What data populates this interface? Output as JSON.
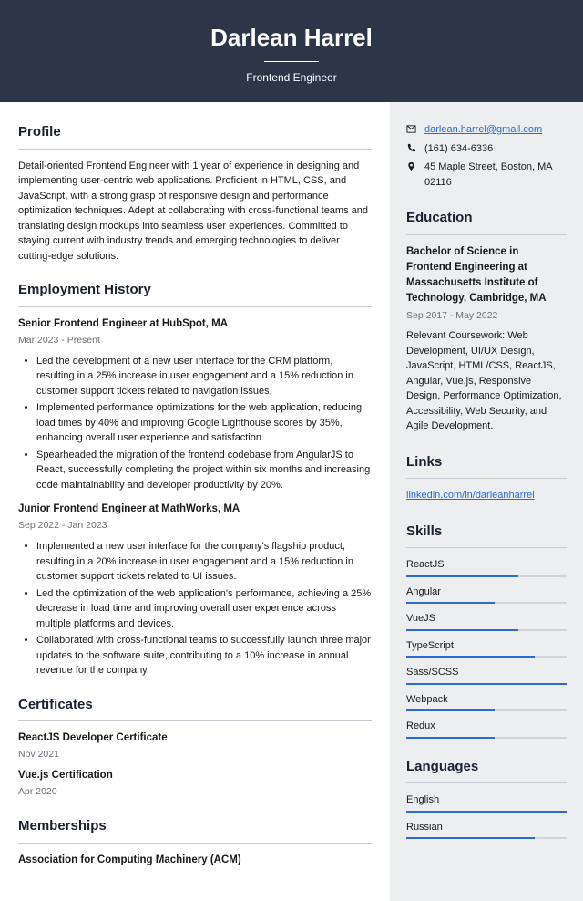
{
  "header": {
    "name": "Darlean Harrel",
    "role": "Frontend Engineer"
  },
  "profile": {
    "heading": "Profile",
    "text": "Detail-oriented Frontend Engineer with 1 year of experience in designing and implementing user-centric web applications. Proficient in HTML, CSS, and JavaScript, with a strong grasp of responsive design and performance optimization techniques. Adept at collaborating with cross-functional teams and translating design mockups into seamless user experiences. Committed to staying current with industry trends and emerging technologies to deliver cutting-edge solutions."
  },
  "employment": {
    "heading": "Employment History",
    "jobs": [
      {
        "title": "Senior Frontend Engineer at HubSpot, MA",
        "dates": "Mar 2023 - Present",
        "bullets": [
          "Led the development of a new user interface for the CRM platform, resulting in a 25% increase in user engagement and a 15% reduction in customer support tickets related to navigation issues.",
          "Implemented performance optimizations for the web application, reducing load times by 40% and improving Google Lighthouse scores by 35%, enhancing overall user experience and satisfaction.",
          "Spearheaded the migration of the frontend codebase from AngularJS to React, successfully completing the project within six months and increasing code maintainability and developer productivity by 20%."
        ]
      },
      {
        "title": "Junior Frontend Engineer at MathWorks, MA",
        "dates": "Sep 2022 - Jan 2023",
        "bullets": [
          "Implemented a new user interface for the company's flagship product, resulting in a 20% increase in user engagement and a 15% reduction in customer support tickets related to UI issues.",
          "Led the optimization of the web application's performance, achieving a 25% decrease in load time and improving overall user experience across multiple platforms and devices.",
          "Collaborated with cross-functional teams to successfully launch three major updates to the software suite, contributing to a 10% increase in annual revenue for the company."
        ]
      }
    ]
  },
  "certificates": {
    "heading": "Certificates",
    "items": [
      {
        "title": "ReactJS Developer Certificate",
        "date": "Nov 2021"
      },
      {
        "title": "Vue.js Certification",
        "date": "Apr 2020"
      }
    ]
  },
  "memberships": {
    "heading": "Memberships",
    "items": [
      {
        "title": "Association for Computing Machinery (ACM)"
      }
    ]
  },
  "contact": {
    "email": "darlean.harrel@gmail.com",
    "phone": "(161) 634-6336",
    "address": "45 Maple Street, Boston, MA 02116"
  },
  "education": {
    "heading": "Education",
    "title": "Bachelor of Science in Frontend Engineering at Massachusetts Institute of Technology, Cambridge, MA",
    "dates": "Sep 2017 - May 2022",
    "text": "Relevant Coursework: Web Development, UI/UX Design, JavaScript, HTML/CSS, ReactJS, Angular, Vue.js, Responsive Design, Performance Optimization, Accessibility, Web Security, and Agile Development."
  },
  "links": {
    "heading": "Links",
    "url": "linkedin.com/in/darleanharrel"
  },
  "skills": {
    "heading": "Skills",
    "items": [
      {
        "name": "ReactJS",
        "level": 70
      },
      {
        "name": "Angular",
        "level": 55
      },
      {
        "name": "VueJS",
        "level": 70
      },
      {
        "name": "TypeScript",
        "level": 80
      },
      {
        "name": "Sass/SCSS",
        "level": 100
      },
      {
        "name": "Webpack",
        "level": 55
      },
      {
        "name": "Redux",
        "level": 55
      }
    ]
  },
  "languages": {
    "heading": "Languages",
    "items": [
      {
        "name": "English",
        "level": 100
      },
      {
        "name": "Russian",
        "level": 80
      }
    ]
  }
}
